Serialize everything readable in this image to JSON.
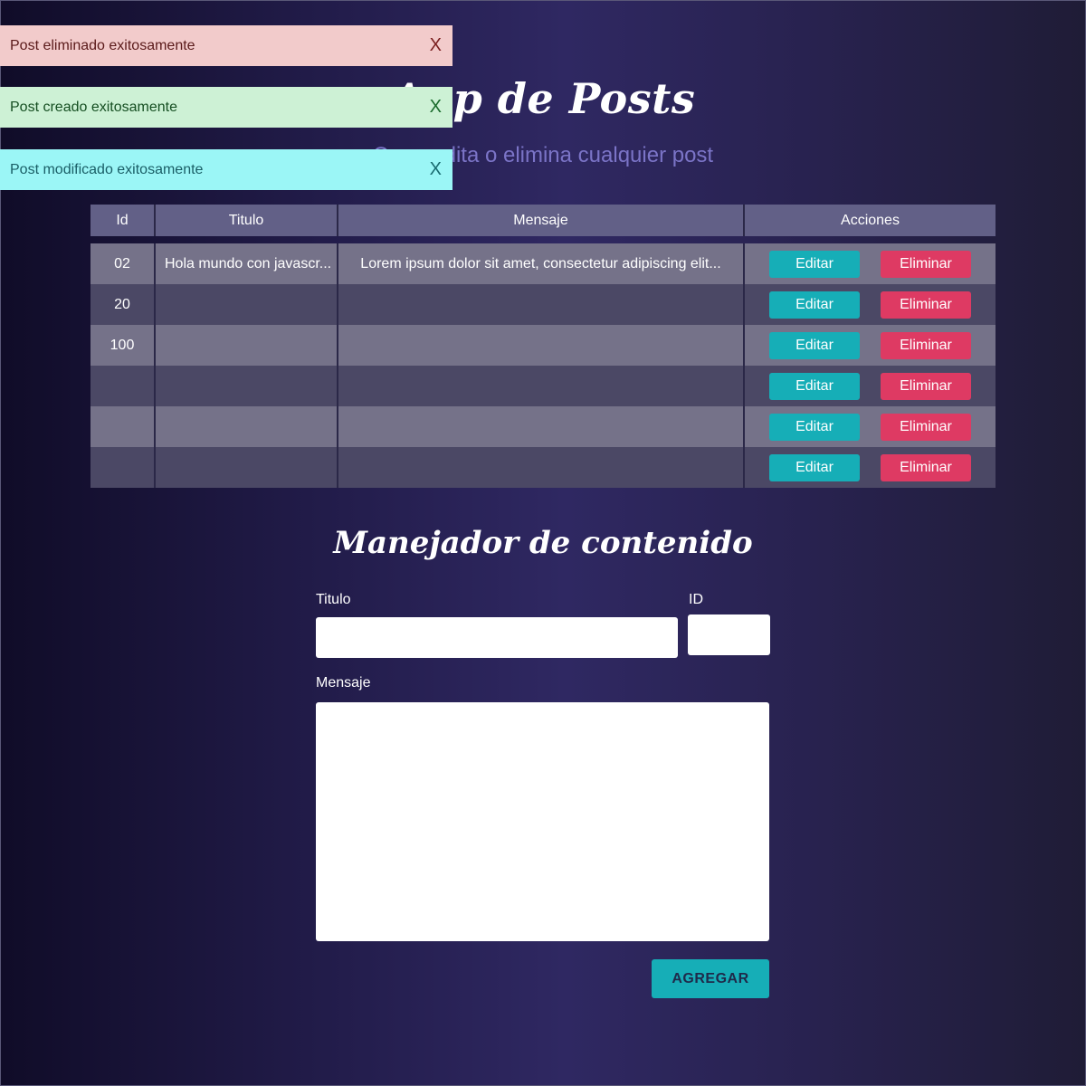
{
  "header": {
    "title": "App de Posts",
    "subtitle": "Crea, edita o elimina cualquier post"
  },
  "toasts": [
    {
      "text": "Post eliminado exitosamente",
      "close": "X"
    },
    {
      "text": "Post creado exitosamente",
      "close": "X"
    },
    {
      "text": "Post modificado exitosamente",
      "close": "X"
    }
  ],
  "table": {
    "headers": {
      "id": "Id",
      "title": "Titulo",
      "message": "Mensaje",
      "actions": "Acciones"
    },
    "edit_label": "Editar",
    "delete_label": "Eliminar",
    "rows": [
      {
        "id": "02",
        "title": "Hola mundo con javascr...",
        "message": "Lorem ipsum dolor sit amet, consectetur adipiscing elit..."
      },
      {
        "id": "20",
        "title": "",
        "message": ""
      },
      {
        "id": "100",
        "title": "",
        "message": ""
      },
      {
        "id": "",
        "title": "",
        "message": ""
      },
      {
        "id": "",
        "title": "",
        "message": ""
      },
      {
        "id": "",
        "title": "",
        "message": ""
      }
    ]
  },
  "form": {
    "title": "Manejador de contenido",
    "titulo_label": "Titulo",
    "titulo_value": "",
    "id_label": "ID",
    "id_value": "",
    "mensaje_label": "Mensaje",
    "mensaje_value": "",
    "submit_label": "AGREGAR"
  },
  "colors": {
    "edit": "#16aeb7",
    "delete": "#de3a63",
    "toast_danger": "#f2cbcb",
    "toast_success": "#cdf1d5",
    "toast_info": "#9bf6f6"
  }
}
